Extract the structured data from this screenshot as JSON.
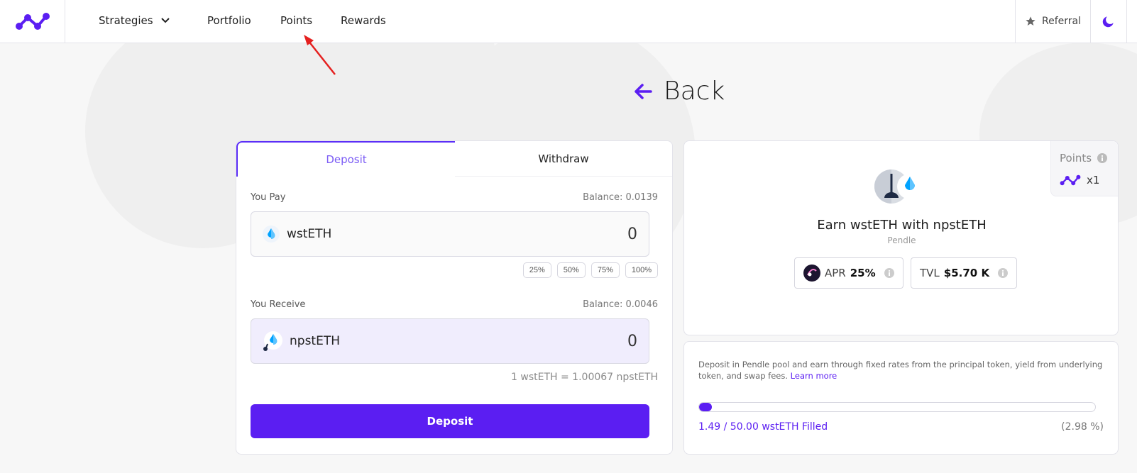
{
  "header": {
    "nav": [
      {
        "label": "Strategies"
      },
      {
        "label": "Portfolio"
      },
      {
        "label": "Points"
      },
      {
        "label": "Rewards"
      }
    ],
    "referral_label": "Referral"
  },
  "back_label": "Back",
  "vault": {
    "tabs": [
      {
        "label": "Deposit"
      },
      {
        "label": "Withdraw"
      }
    ],
    "you_pay_label": "You Pay",
    "pay_balance": "Balance: 0.0139",
    "pay_token": "wstETH",
    "pay_value": "0",
    "pct_options": [
      "25%",
      "50%",
      "75%",
      "100%"
    ],
    "you_receive_label": "You Receive",
    "receive_balance": "Balance: 0.0046",
    "receive_token": "npstETH",
    "receive_value": "0",
    "rate": "1 wstETH = 1.00067 npstETH",
    "deposit_button": "Deposit"
  },
  "strategy": {
    "points_label": "Points",
    "points_multiplier": "x1",
    "title": "Earn wstETH with npstETH",
    "protocol": "Pendle",
    "apr_label": "APR",
    "apr_value": "25%",
    "tvl_label": "TVL",
    "tvl_value": "$5.70 K"
  },
  "info": {
    "description": "Deposit in Pendle pool and earn through fixed rates from the principal token, yield from underlying token, and swap fees.",
    "learn_more": "Learn more",
    "filled_text": "1.49 / 50.00 wstETH Filled",
    "filled_pct": "(2.98 %)",
    "fill_fraction": 0.0298
  },
  "colors": {
    "accent": "#5b1ef2",
    "accent_light": "#7b5cf5",
    "annotation_arrow": "#e5201f"
  }
}
